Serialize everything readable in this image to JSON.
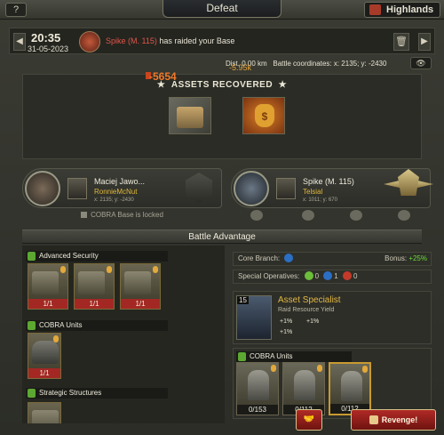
{
  "topbar": {
    "help": "?",
    "title": "Defeat",
    "location": "Highlands"
  },
  "message": {
    "time": "20:35",
    "date": "31-05-2023",
    "attacker": "Spike (M. 115)",
    "text": " has raided your Base",
    "prev": "◀",
    "next": "▶",
    "trash": "🗑"
  },
  "battle_info": {
    "distance_label": "Dist. 0.00 km",
    "coords_label": "Battle coordinates:",
    "coords_value": "x: 2135; y: -2430",
    "eye": "👁"
  },
  "assets": {
    "title": "ASSETS RECOVERED",
    "items": [
      {
        "icon": "supply-crate-icon",
        "value": "-5654"
      },
      {
        "icon": "money-bag-icon",
        "value": "-5.95k"
      }
    ]
  },
  "defender": {
    "name": "Maciej Jawo...",
    "alias": "RonnieMcNut",
    "coords": "x: 2135; y: -2430",
    "locked_text": "COBRA Base is locked"
  },
  "attacker": {
    "name": "Spike (M. 115)",
    "alias": "Telsial",
    "coords": "x: 1011; y: 670"
  },
  "battle_advantage": {
    "header": "Battle Advantage",
    "sections": [
      {
        "title": "Advanced Security",
        "cards": [
          "1/1",
          "1/1",
          "1/1"
        ]
      },
      {
        "title": "COBRA Units",
        "cards": [
          "1/1"
        ]
      },
      {
        "title": "Strategic Structures",
        "cards": []
      }
    ],
    "core_branch": "Core Branch:",
    "bonus_label": "Bonus:",
    "bonus_value": "+25%",
    "special_ops_label": "Special Operatives:",
    "special_ops": [
      "0",
      "1",
      "0"
    ],
    "specialist": {
      "level": "15",
      "title": "Asset Specialist",
      "subtitle": "Raid Resource Yield",
      "bonuses": [
        "+1%",
        "+1%",
        "+1%"
      ]
    },
    "cobra_units_title": "COBRA Units",
    "units": [
      "0/153",
      "0/112",
      "0/112"
    ]
  },
  "buttons": {
    "revenge": "Revenge!",
    "hand": "🤝"
  },
  "colors": {
    "accent_red": "#a32824",
    "bonus_green": "#6bdc3a",
    "raider_name": "#e0554a",
    "gold": "#e3b845"
  }
}
